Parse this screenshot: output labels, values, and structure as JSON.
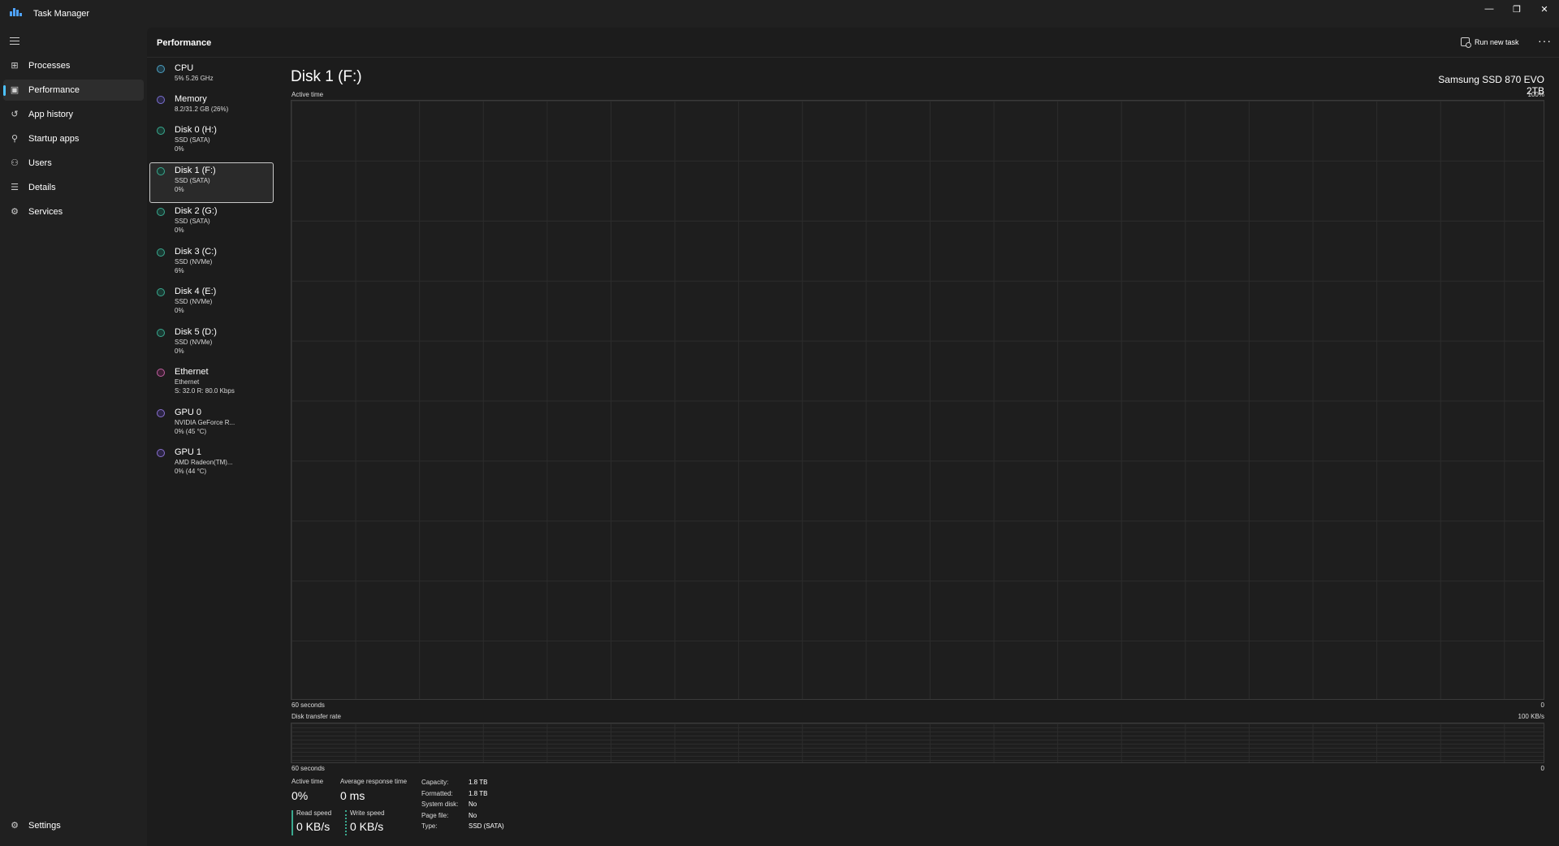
{
  "window": {
    "title": "Task Manager",
    "minimize_glyph": "—",
    "maximize_glyph": "❐",
    "close_glyph": "✕"
  },
  "nav": {
    "items": [
      {
        "label": "Processes",
        "icon": "processes-icon",
        "glyph": "⊞"
      },
      {
        "label": "Performance",
        "icon": "performance-icon",
        "glyph": "▣",
        "active": true
      },
      {
        "label": "App history",
        "icon": "history-icon",
        "glyph": "↺"
      },
      {
        "label": "Startup apps",
        "icon": "startup-icon",
        "glyph": "⚲"
      },
      {
        "label": "Users",
        "icon": "users-icon",
        "glyph": "⚇"
      },
      {
        "label": "Details",
        "icon": "details-icon",
        "glyph": "☰"
      },
      {
        "label": "Services",
        "icon": "services-icon",
        "glyph": "⚙"
      }
    ],
    "settings": {
      "label": "Settings",
      "icon": "settings-icon",
      "glyph": "⚙"
    }
  },
  "header": {
    "title": "Performance",
    "run_new_task": "Run new task",
    "more": "···"
  },
  "devices": [
    {
      "name": "CPU",
      "line1": "5%  5.26 GHz",
      "line2": "",
      "color": "#4ea0c2"
    },
    {
      "name": "Memory",
      "line1": "8.2/31.2 GB (26%)",
      "line2": "",
      "color": "#7a6fd0"
    },
    {
      "name": "Disk 0 (H:)",
      "line1": "SSD (SATA)",
      "line2": "0%",
      "color": "#3aa98f"
    },
    {
      "name": "Disk 1 (F:)",
      "line1": "SSD (SATA)",
      "line2": "0%",
      "color": "#3aa98f",
      "selected": true
    },
    {
      "name": "Disk 2 (G:)",
      "line1": "SSD (SATA)",
      "line2": "0%",
      "color": "#3aa98f"
    },
    {
      "name": "Disk 3 (C:)",
      "line1": "SSD (NVMe)",
      "line2": "6%",
      "color": "#3aa98f"
    },
    {
      "name": "Disk 4 (E:)",
      "line1": "SSD (NVMe)",
      "line2": "0%",
      "color": "#3aa98f"
    },
    {
      "name": "Disk 5 (D:)",
      "line1": "SSD (NVMe)",
      "line2": "0%",
      "color": "#3aa98f"
    },
    {
      "name": "Ethernet",
      "line1": "Ethernet",
      "line2": "S: 32.0  R: 80.0 Kbps",
      "color": "#c060a0"
    },
    {
      "name": "GPU 0",
      "line1": "NVIDIA GeForce R...",
      "line2": "0% (45 °C)",
      "color": "#8a70d0"
    },
    {
      "name": "GPU 1",
      "line1": "AMD Radeon(TM)...",
      "line2": "0% (44 °C)",
      "color": "#8a70d0"
    }
  ],
  "detail": {
    "title": "Disk 1 (F:)",
    "model": "Samsung SSD 870 EVO 2TB",
    "active_time_label": "Active time",
    "active_time_max": "100%",
    "graph1_left": "60 seconds",
    "graph1_right": "0",
    "transfer_label": "Disk transfer rate",
    "transfer_max": "100 KB/s",
    "graph2_left": "60 seconds",
    "graph2_right": "0"
  },
  "stats": {
    "active_time": {
      "label": "Active time",
      "value": "0%"
    },
    "avg_response": {
      "label": "Average response time",
      "value": "0 ms"
    },
    "read_speed": {
      "label": "Read speed",
      "value": "0 KB/s"
    },
    "write_speed": {
      "label": "Write speed",
      "value": "0 KB/s"
    },
    "info": [
      {
        "key": "Capacity:",
        "value": "1.8 TB"
      },
      {
        "key": "Formatted:",
        "value": "1.8 TB"
      },
      {
        "key": "System disk:",
        "value": "No"
      },
      {
        "key": "Page file:",
        "value": "No"
      },
      {
        "key": "Type:",
        "value": "SSD (SATA)"
      }
    ]
  },
  "colors": {
    "accent": "#4cc2ff",
    "disk": "#3aa98f",
    "background": "#202020",
    "panel": "#1c1c1c"
  }
}
